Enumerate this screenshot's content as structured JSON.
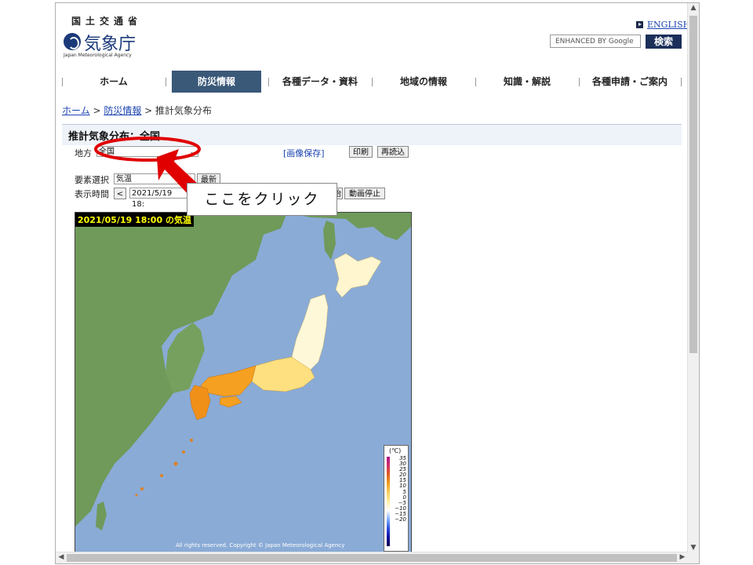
{
  "header": {
    "logo_ja_top": "国土交通省",
    "logo_main": "気象庁",
    "logo_en": "Japan Meteorological Agency",
    "english_link": "ENGLISH",
    "search_placeholder": "ENHANCED BY Google",
    "search_button": "検索"
  },
  "nav": {
    "items": [
      {
        "label": "ホーム"
      },
      {
        "label": "防災情報"
      },
      {
        "label": "各種データ・資料"
      },
      {
        "label": "地域の情報"
      },
      {
        "label": "知識・解説"
      },
      {
        "label": "各種申請・ご案内"
      }
    ],
    "active_index": 1
  },
  "breadcrumb": {
    "home": "ホーム",
    "sep1": " > ",
    "disaster": "防災情報",
    "sep2": " > ",
    "current": "推計気象分布"
  },
  "page": {
    "title": "推計気象分布：全国"
  },
  "controls": {
    "region_label": "地方",
    "region_value": "全国",
    "save_link": "[画像保存]",
    "print_button": "印刷",
    "reload_button": "再読込",
    "element_label": "要素選択",
    "element_value": "気温",
    "latest_button": "最新",
    "time_label": "表示時間",
    "prev_button": "<",
    "time_value": "2021/5/19 18:",
    "anim_start_button": "始",
    "anim_stop_button": "動画停止"
  },
  "map": {
    "title": "2021/05/19 18:00 の気温",
    "copyright": "All rights reserved. Copyright © Japan Meteorological Agency",
    "legend_unit": "(℃)",
    "legend_labels": [
      "35",
      "30",
      "25",
      "20",
      "15",
      "10",
      "5",
      "0",
      "−5",
      "−10",
      "−15",
      "−20"
    ]
  },
  "annotation": {
    "callout_text": "ここをクリック",
    "highlight_color": "#e00000"
  },
  "colors": {
    "nav_active": "#3a5878",
    "search_button": "#1b2f5a",
    "link": "#1a44b0",
    "sea": "#8aabd6",
    "land": "#6f9a5a"
  }
}
